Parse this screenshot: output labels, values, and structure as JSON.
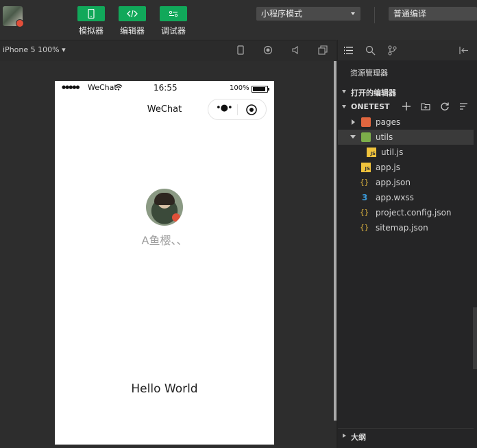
{
  "toolbar": {
    "buttons": [
      {
        "label": "模拟器",
        "icon": "phone-icon"
      },
      {
        "label": "编辑器",
        "icon": "code-icon"
      },
      {
        "label": "调试器",
        "icon": "debug-icon"
      }
    ],
    "mode_select": "小程序模式",
    "compile_select": "普通编译",
    "accent_color": "#11a85a"
  },
  "simulator": {
    "device": "iPhone 5 100% ▾",
    "status_bar": {
      "signal": "●●●●●",
      "carrier": "WeChat",
      "time": "16:55",
      "battery": "100%"
    },
    "nav_title": "WeChat",
    "capsule_more": "•●•",
    "nickname": "A鱼樱、、",
    "hello": "Hello World"
  },
  "explorer": {
    "title": "资源管理器",
    "open_editors": "打开的编辑器",
    "project": "ONETEST",
    "outline": "大纲",
    "tree": [
      {
        "label": "pages",
        "type": "folder",
        "state": "collapsed"
      },
      {
        "label": "utils",
        "type": "folder",
        "state": "expanded"
      },
      {
        "label": "util.js",
        "type": "js"
      },
      {
        "label": "app.js",
        "type": "js"
      },
      {
        "label": "app.json",
        "type": "json"
      },
      {
        "label": "app.wxss",
        "type": "css"
      },
      {
        "label": "project.config.json",
        "type": "json"
      },
      {
        "label": "sitemap.json",
        "type": "json"
      }
    ]
  }
}
